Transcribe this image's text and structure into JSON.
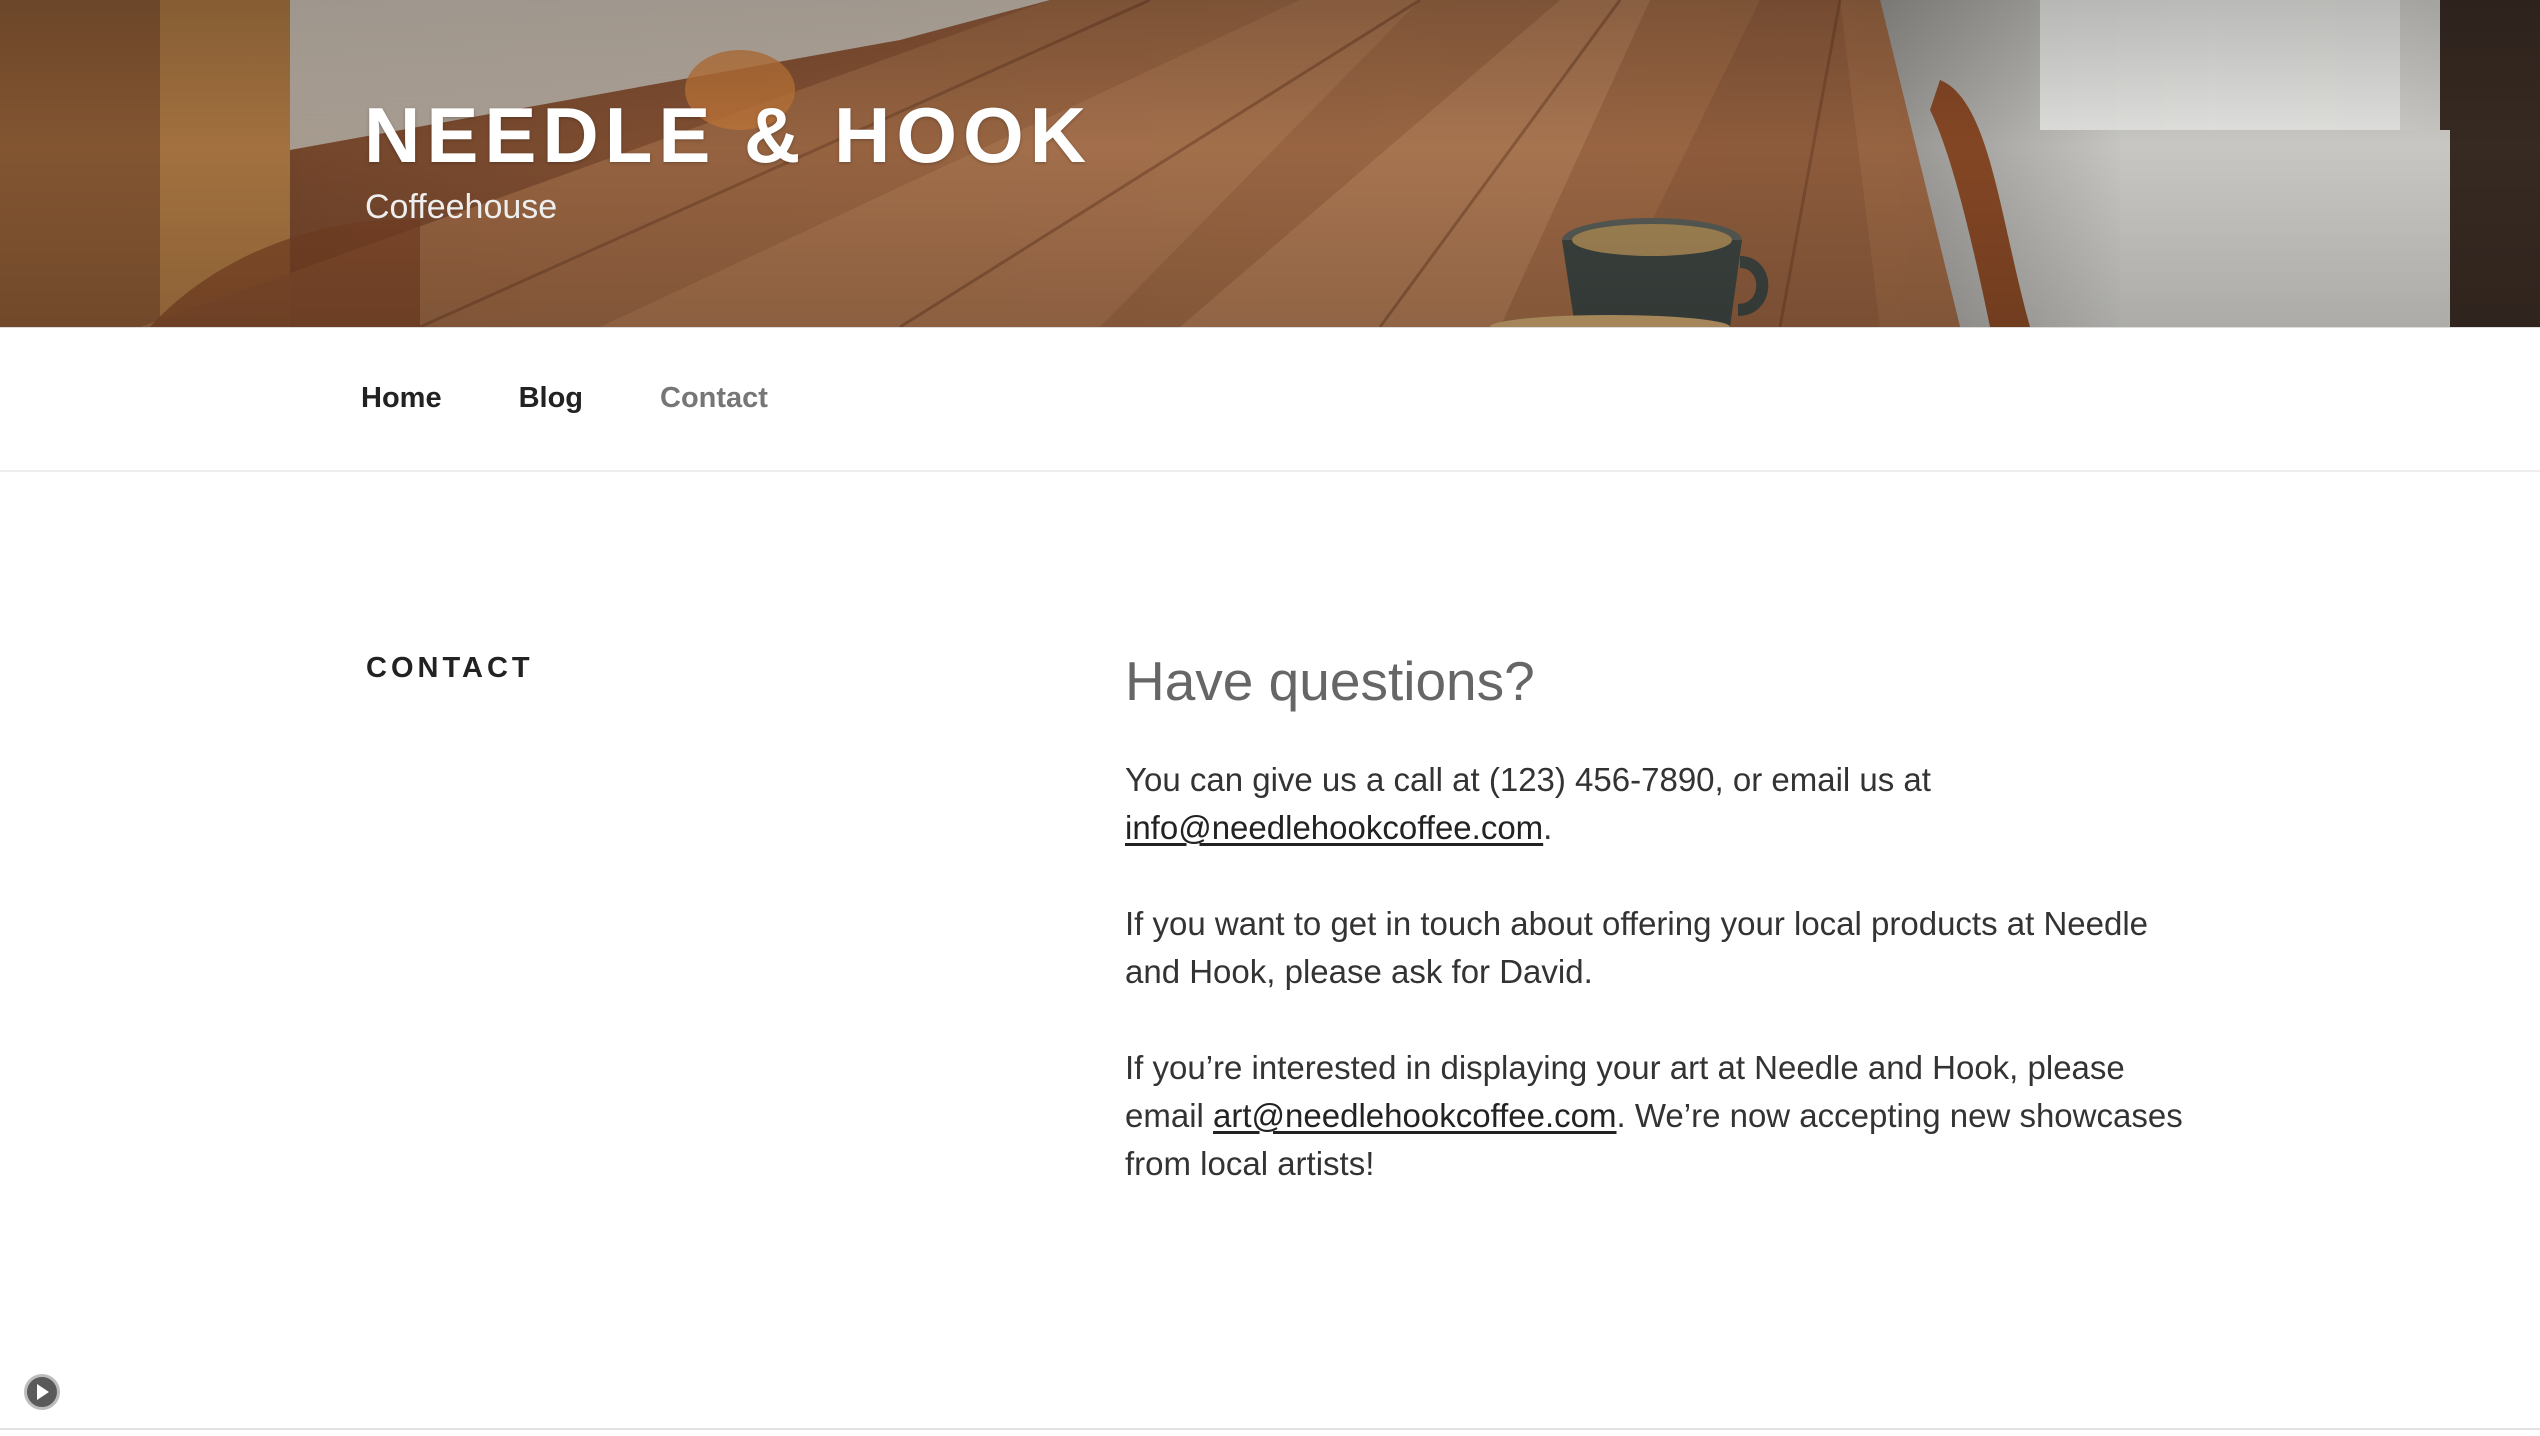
{
  "header": {
    "site_title": "NEEDLE & HOOK",
    "tagline": "Coffeehouse"
  },
  "nav": {
    "items": [
      {
        "label": "Home",
        "current": false
      },
      {
        "label": "Blog",
        "current": false
      },
      {
        "label": "Contact",
        "current": true
      }
    ]
  },
  "page": {
    "title": "CONTACT",
    "heading": "Have questions?",
    "p1": {
      "before": "You can give us a call at (123) 456-7890, or email us at ",
      "link": "info@needlehookcoffee.com",
      "after": "."
    },
    "p2": "If you want to get in touch about offering your local products at Needle and Hook, please ask for David.",
    "p3": {
      "before": "If you’re interested in displaying your art at Needle and Hook, please email ",
      "link": "art@needlehookcoffee.com",
      "after": ". We’re now accepting new showcases from local artists!"
    }
  },
  "icons": {
    "play": "play-icon"
  },
  "colors": {
    "nav_current": "#767676",
    "heading_gray": "#666666",
    "text": "#333333"
  }
}
